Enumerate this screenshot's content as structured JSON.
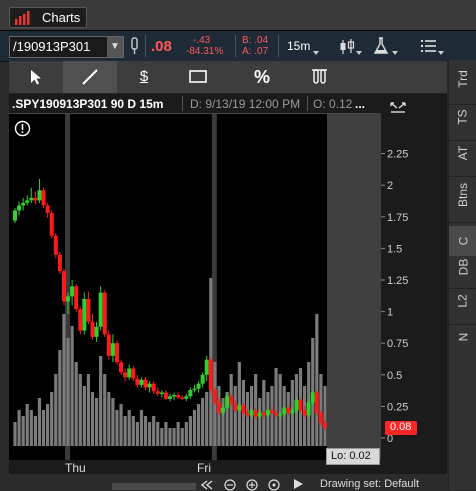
{
  "window": {
    "title": "Charts"
  },
  "header": {
    "symbol": "/190913P301",
    "last_price": ".08",
    "net_change": "-.43",
    "net_change_pct": "-84.31%",
    "bid": "B: .04",
    "ask": "A: .07",
    "timeframe": "15m"
  },
  "toolbar": {
    "tools": [
      "cursor",
      "line",
      "price-level",
      "rectangle",
      "percent",
      "studies"
    ],
    "percent_label": "%",
    "dollar_label": "$"
  },
  "chart": {
    "title": ".SPY190913P301 90 D 15m",
    "date_label": "D: 9/13/19 12:00 PM",
    "open_label": "O: 0.12",
    "more_label": "...",
    "low_label": "Lo: 0.02",
    "current_price_badge": "0.08",
    "x_labels": [
      "Thu",
      "Fri"
    ],
    "drawing_set": "Drawing set: Default",
    "colors": {
      "up": "#2fd12f",
      "down": "#ff1a1a",
      "volume": "#7b7b7b",
      "badge": "#ff2626"
    }
  },
  "chart_data": {
    "type": "bar",
    "title": ".SPY190913P301 90 D 15m",
    "yticks": [
      "2.25",
      "2",
      "1.75",
      "1.5",
      "1.25",
      "1",
      "0.75",
      "0.5",
      "0.25",
      "0"
    ],
    "ylim": [
      0,
      2.5
    ],
    "categories": [
      "Thu",
      "Fri"
    ],
    "candles": [
      [
        1.72,
        1.82,
        1.7,
        1.8
      ],
      [
        1.8,
        1.87,
        1.76,
        1.84
      ],
      [
        1.84,
        1.9,
        1.8,
        1.86
      ],
      [
        1.86,
        1.92,
        1.84,
        1.88
      ],
      [
        1.88,
        1.98,
        1.86,
        1.9
      ],
      [
        1.9,
        1.95,
        1.85,
        1.88
      ],
      [
        1.88,
        2.05,
        1.86,
        1.96
      ],
      [
        1.96,
        1.98,
        1.82,
        1.84
      ],
      [
        1.84,
        1.86,
        1.74,
        1.78
      ],
      [
        1.78,
        1.8,
        1.58,
        1.6
      ],
      [
        1.6,
        1.62,
        1.42,
        1.45
      ],
      [
        1.45,
        1.47,
        1.3,
        1.32
      ],
      [
        1.32,
        1.34,
        1.05,
        1.08
      ],
      [
        1.08,
        1.15,
        0.98,
        1.12
      ],
      [
        1.12,
        1.25,
        1.05,
        1.2
      ],
      [
        1.2,
        1.22,
        1.0,
        1.02
      ],
      [
        1.02,
        1.04,
        0.82,
        0.85
      ],
      [
        0.85,
        1.15,
        0.82,
        1.1
      ],
      [
        1.1,
        1.16,
        0.9,
        0.92
      ],
      [
        0.92,
        0.98,
        0.78,
        0.8
      ],
      [
        0.8,
        0.92,
        0.76,
        0.88
      ],
      [
        0.88,
        1.2,
        0.85,
        1.15
      ],
      [
        1.15,
        1.17,
        0.8,
        0.82
      ],
      [
        0.82,
        0.85,
        0.62,
        0.65
      ],
      [
        0.65,
        0.82,
        0.6,
        0.75
      ],
      [
        0.75,
        0.77,
        0.58,
        0.6
      ],
      [
        0.6,
        0.62,
        0.5,
        0.52
      ],
      [
        0.52,
        0.55,
        0.45,
        0.48
      ],
      [
        0.48,
        0.58,
        0.46,
        0.55
      ],
      [
        0.55,
        0.57,
        0.45,
        0.47
      ],
      [
        0.47,
        0.5,
        0.4,
        0.42
      ],
      [
        0.42,
        0.48,
        0.4,
        0.46
      ],
      [
        0.46,
        0.48,
        0.38,
        0.4
      ],
      [
        0.4,
        0.45,
        0.36,
        0.43
      ],
      [
        0.43,
        0.45,
        0.35,
        0.37
      ],
      [
        0.37,
        0.4,
        0.33,
        0.35
      ],
      [
        0.35,
        0.38,
        0.32,
        0.36
      ],
      [
        0.36,
        0.38,
        0.3,
        0.31
      ],
      [
        0.31,
        0.35,
        0.29,
        0.33
      ],
      [
        0.33,
        0.36,
        0.3,
        0.34
      ],
      [
        0.34,
        0.36,
        0.31,
        0.32
      ],
      [
        0.32,
        0.34,
        0.3,
        0.31
      ],
      [
        0.31,
        0.35,
        0.29,
        0.33
      ],
      [
        0.33,
        0.4,
        0.31,
        0.38
      ],
      [
        0.38,
        0.42,
        0.36,
        0.39
      ],
      [
        0.39,
        0.45,
        0.36,
        0.43
      ],
      [
        0.43,
        0.52,
        0.4,
        0.5
      ],
      [
        0.5,
        0.65,
        0.45,
        0.62
      ],
      [
        0.62,
        0.64,
        0.35,
        0.38
      ],
      [
        0.38,
        0.4,
        0.26,
        0.28
      ],
      [
        0.28,
        0.32,
        0.18,
        0.2
      ],
      [
        0.2,
        0.27,
        0.17,
        0.24
      ],
      [
        0.24,
        0.36,
        0.22,
        0.33
      ],
      [
        0.33,
        0.35,
        0.25,
        0.27
      ],
      [
        0.27,
        0.3,
        0.2,
        0.22
      ],
      [
        0.22,
        0.28,
        0.2,
        0.26
      ],
      [
        0.26,
        0.28,
        0.18,
        0.2
      ],
      [
        0.2,
        0.23,
        0.16,
        0.18
      ],
      [
        0.18,
        0.24,
        0.16,
        0.22
      ],
      [
        0.22,
        0.24,
        0.15,
        0.17
      ],
      [
        0.17,
        0.22,
        0.15,
        0.2
      ],
      [
        0.2,
        0.22,
        0.16,
        0.18
      ],
      [
        0.18,
        0.24,
        0.16,
        0.22
      ],
      [
        0.22,
        0.25,
        0.18,
        0.2
      ],
      [
        0.2,
        0.22,
        0.16,
        0.18
      ],
      [
        0.18,
        0.21,
        0.15,
        0.19
      ],
      [
        0.19,
        0.26,
        0.17,
        0.24
      ],
      [
        0.24,
        0.26,
        0.18,
        0.2
      ],
      [
        0.2,
        0.24,
        0.18,
        0.22
      ],
      [
        0.22,
        0.32,
        0.2,
        0.3
      ],
      [
        0.3,
        0.32,
        0.2,
        0.22
      ],
      [
        0.22,
        0.25,
        0.16,
        0.18
      ],
      [
        0.18,
        0.3,
        0.16,
        0.28
      ],
      [
        0.28,
        0.38,
        0.25,
        0.36
      ],
      [
        0.36,
        0.38,
        0.18,
        0.2
      ],
      [
        0.2,
        0.22,
        0.1,
        0.12
      ],
      [
        0.12,
        0.14,
        0.06,
        0.08
      ]
    ],
    "volume": [
      4,
      6,
      5,
      7,
      6,
      5,
      8,
      6,
      7,
      9,
      12,
      16,
      22,
      18,
      20,
      14,
      12,
      10,
      12,
      9,
      8,
      15,
      12,
      9,
      8,
      6,
      7,
      5,
      6,
      5,
      4,
      6,
      5,
      4,
      5,
      4,
      3,
      4,
      3,
      3,
      4,
      3,
      4,
      5,
      6,
      7,
      8,
      9,
      28,
      14,
      10,
      8,
      9,
      12,
      10,
      14,
      11,
      9,
      10,
      12,
      8,
      11,
      9,
      10,
      13,
      12,
      10,
      9,
      11,
      12,
      13,
      10,
      14,
      18,
      22,
      12,
      10
    ],
    "vol_max": 30,
    "day_markers": [
      13,
      49
    ]
  }
}
